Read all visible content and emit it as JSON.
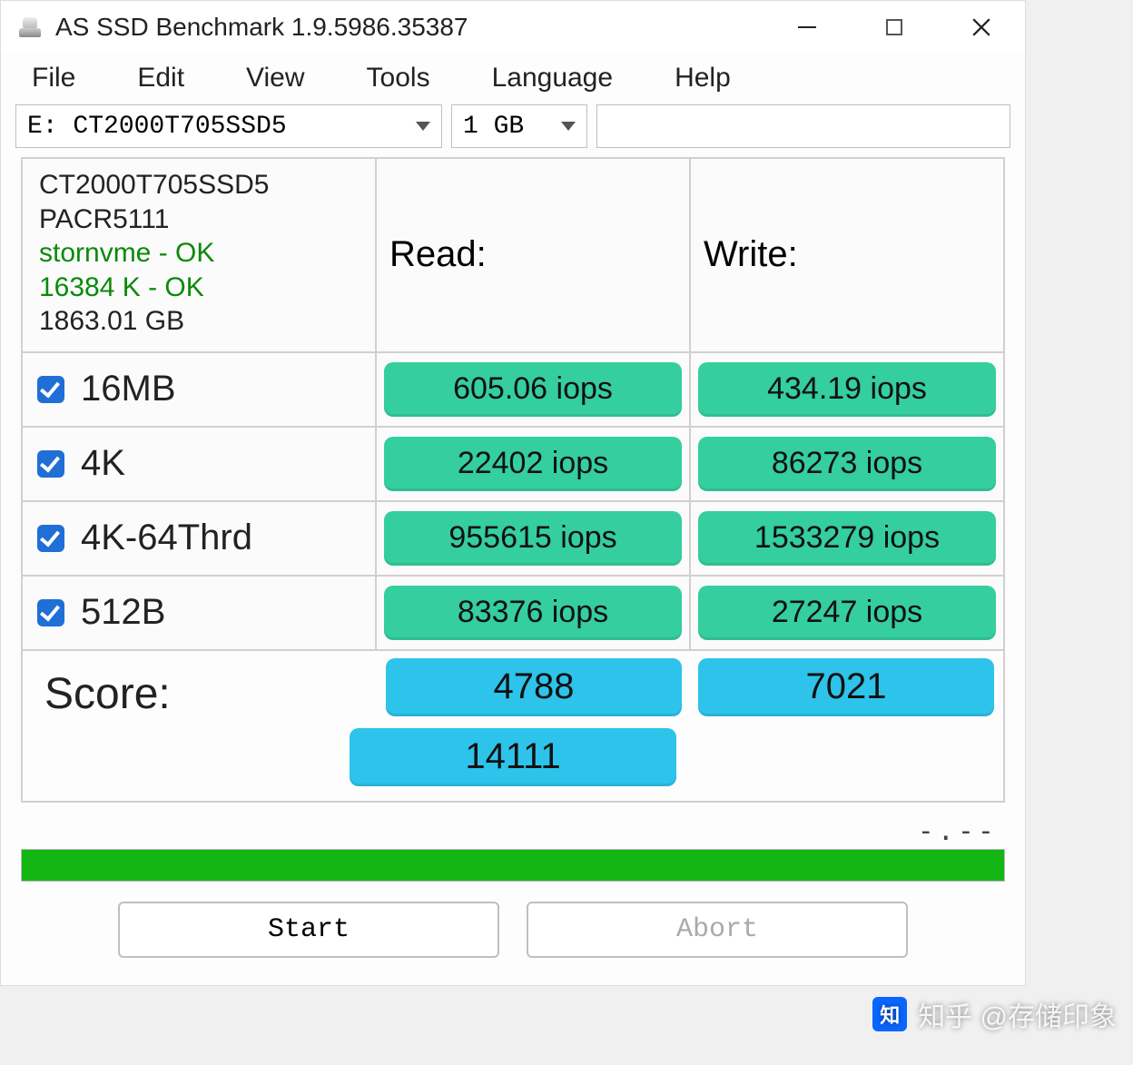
{
  "window": {
    "title": "AS SSD Benchmark 1.9.5986.35387"
  },
  "menu": {
    "file": "File",
    "edit": "Edit",
    "view": "View",
    "tools": "Tools",
    "language": "Language",
    "help": "Help"
  },
  "selectors": {
    "drive": "E: CT2000T705SSD5",
    "size": "1 GB"
  },
  "info": {
    "model": "CT2000T705SSD5",
    "firmware": "PACR5111",
    "driver_status": "stornvme - OK",
    "align_status": "16384 K - OK",
    "capacity": "1863.01 GB"
  },
  "columns": {
    "read": "Read:",
    "write": "Write:"
  },
  "tests": [
    {
      "name": "16MB",
      "read": "605.06 iops",
      "write": "434.19 iops"
    },
    {
      "name": "4K",
      "read": "22402 iops",
      "write": "86273 iops"
    },
    {
      "name": "4K-64Thrd",
      "read": "955615 iops",
      "write": "1533279 iops"
    },
    {
      "name": "512B",
      "read": "83376 iops",
      "write": "27247 iops"
    }
  ],
  "score": {
    "label": "Score:",
    "read": "4788",
    "write": "7021",
    "total": "14111"
  },
  "footer": {
    "dots": "-.--",
    "start": "Start",
    "abort": "Abort"
  },
  "watermark": {
    "logo": "知",
    "text": "知乎 @存储印象"
  },
  "colors": {
    "pill_green": "#35ce9e",
    "pill_blue": "#2dc3ea",
    "progress_green": "#13b613",
    "checkbox_blue": "#1f6fd6"
  }
}
